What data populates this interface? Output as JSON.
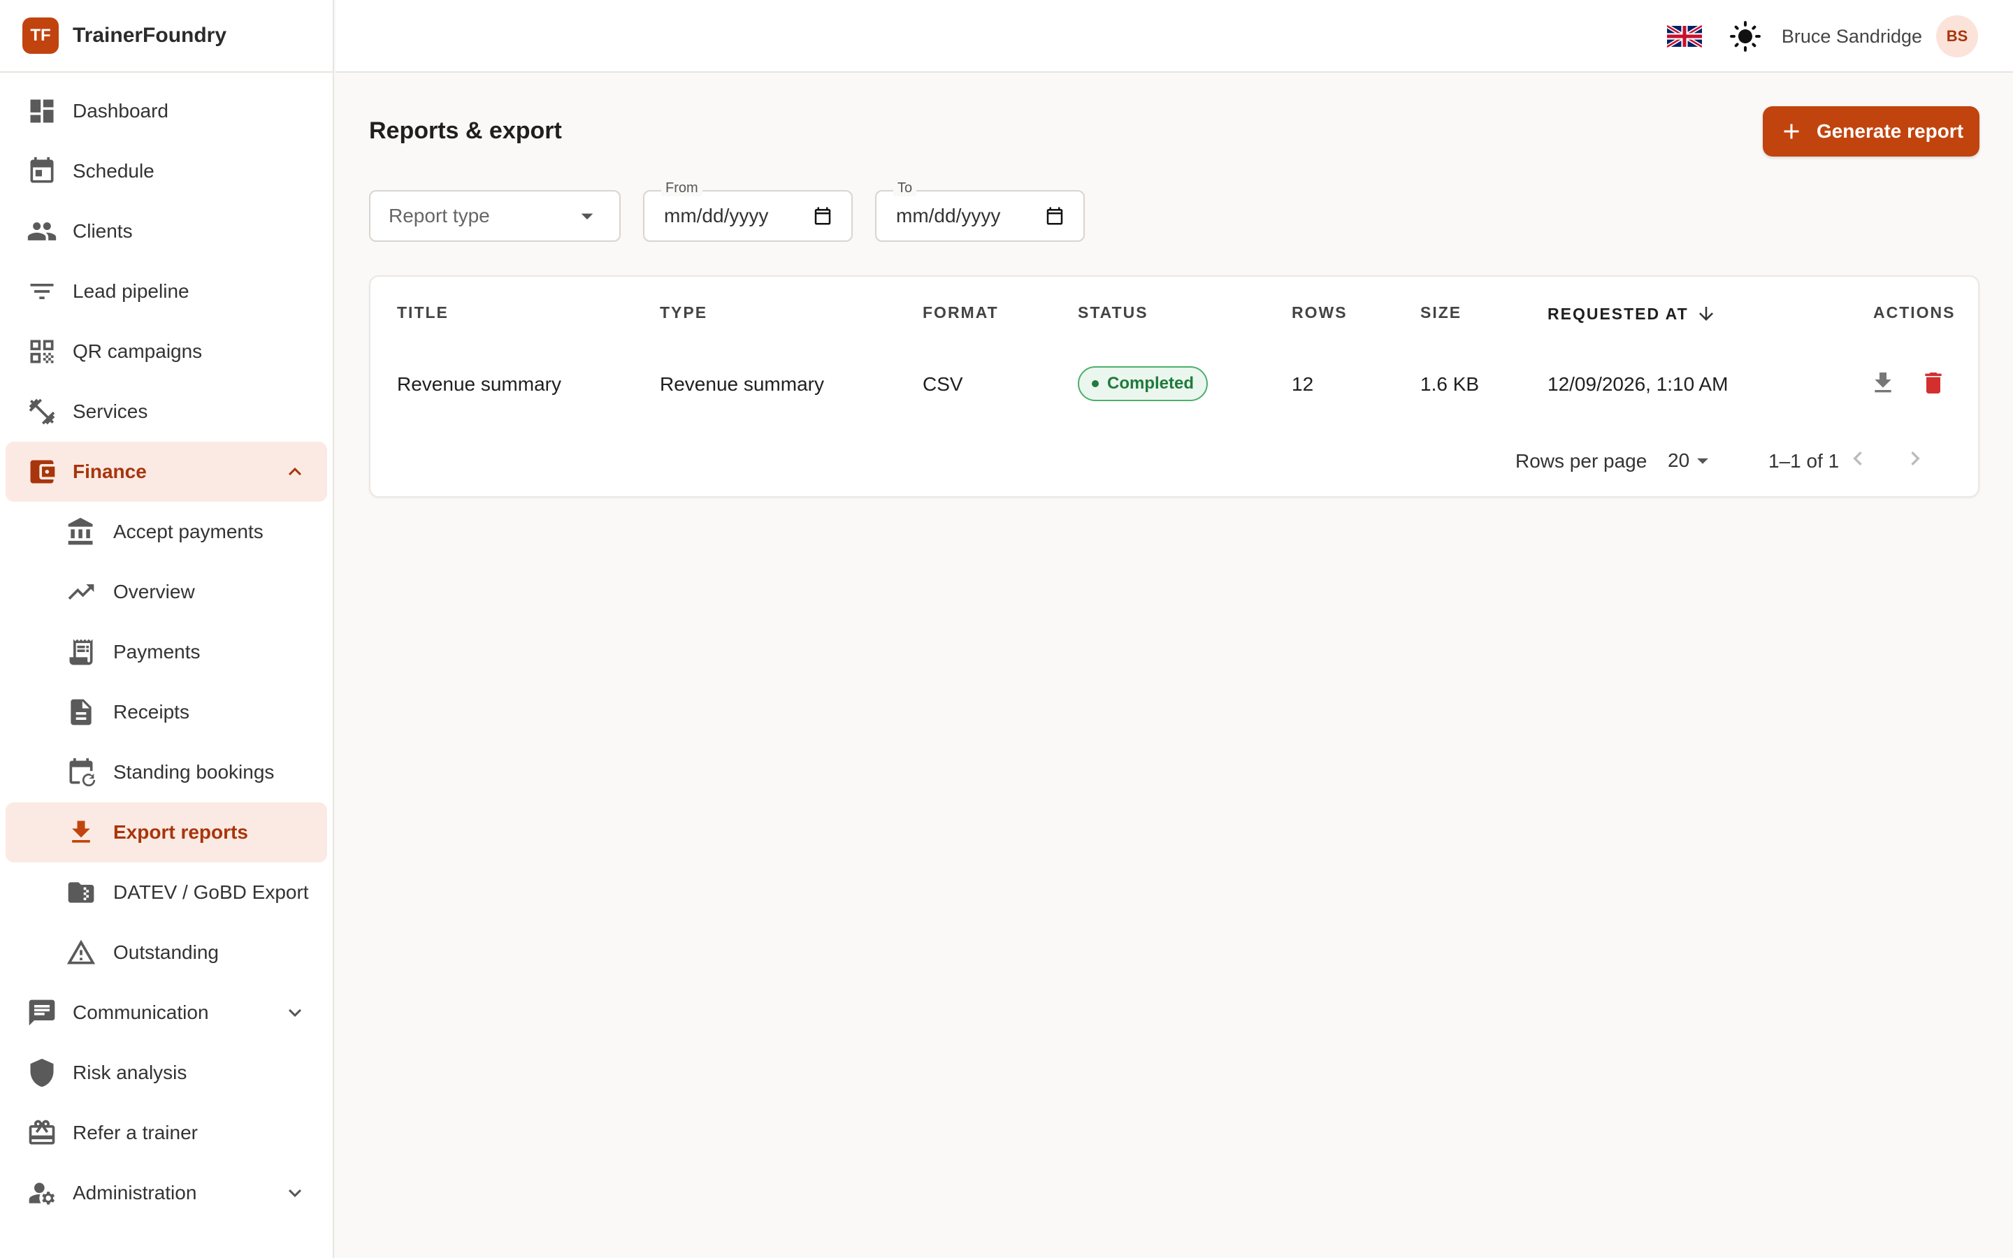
{
  "brand": {
    "logo_text": "TF",
    "name": "TrainerFoundry"
  },
  "sidebar": {
    "items": [
      {
        "label": "Dashboard",
        "icon": "dashboard-icon"
      },
      {
        "label": "Schedule",
        "icon": "calendar-icon"
      },
      {
        "label": "Clients",
        "icon": "people-icon"
      },
      {
        "label": "Lead pipeline",
        "icon": "filter-icon"
      },
      {
        "label": "QR campaigns",
        "icon": "qr-code-icon"
      },
      {
        "label": "Services",
        "icon": "dumbbell-icon"
      },
      {
        "label": "Finance",
        "icon": "wallet-icon",
        "expanded": true
      },
      {
        "label": "Accept payments",
        "icon": "bank-icon"
      },
      {
        "label": "Overview",
        "icon": "trending-up-icon"
      },
      {
        "label": "Payments",
        "icon": "receipt-long-icon"
      },
      {
        "label": "Receipts",
        "icon": "document-icon"
      },
      {
        "label": "Standing bookings",
        "icon": "calendar-repeat-icon"
      },
      {
        "label": "Export reports",
        "icon": "download-icon",
        "active": true
      },
      {
        "label": "DATEV / GoBD Export",
        "icon": "folder-zip-icon"
      },
      {
        "label": "Outstanding",
        "icon": "warning-icon"
      },
      {
        "label": "Communication",
        "icon": "chat-icon"
      },
      {
        "label": "Risk analysis",
        "icon": "shield-icon"
      },
      {
        "label": "Refer a trainer",
        "icon": "gift-card-icon"
      },
      {
        "label": "Administration",
        "icon": "admin-icon"
      }
    ]
  },
  "topbar": {
    "language_icon": "uk-flag-icon",
    "theme_icon": "sun-icon",
    "user_name": "Bruce Sandridge",
    "user_initials": "BS"
  },
  "page": {
    "title": "Reports & export",
    "generate_button": "Generate report"
  },
  "filters": {
    "report_type_placeholder": "Report type",
    "from_label": "From",
    "from_value": "mm/dd/yyyy",
    "to_label": "To",
    "to_value": "mm/dd/yyyy"
  },
  "table": {
    "headers": {
      "title": "TITLE",
      "type": "TYPE",
      "format": "FORMAT",
      "status": "STATUS",
      "rows": "ROWS",
      "size": "SIZE",
      "requested_at": "REQUESTED AT",
      "actions": "ACTIONS"
    },
    "sort": {
      "column": "requested_at",
      "direction": "desc"
    },
    "rows": [
      {
        "title": "Revenue summary",
        "type": "Revenue summary",
        "format": "CSV",
        "status": "Completed",
        "rows": "12",
        "size": "1.6 KB",
        "requested_at": "12/09/2026, 1:10 AM"
      }
    ],
    "pagination": {
      "rows_per_page_label": "Rows per page",
      "rows_per_page": "20",
      "range": "1–1 of 1"
    }
  },
  "colors": {
    "accent": "#c1440e",
    "accent_bg": "#fbeae3",
    "success": "#1f7a3b",
    "danger": "#d32f2f"
  }
}
